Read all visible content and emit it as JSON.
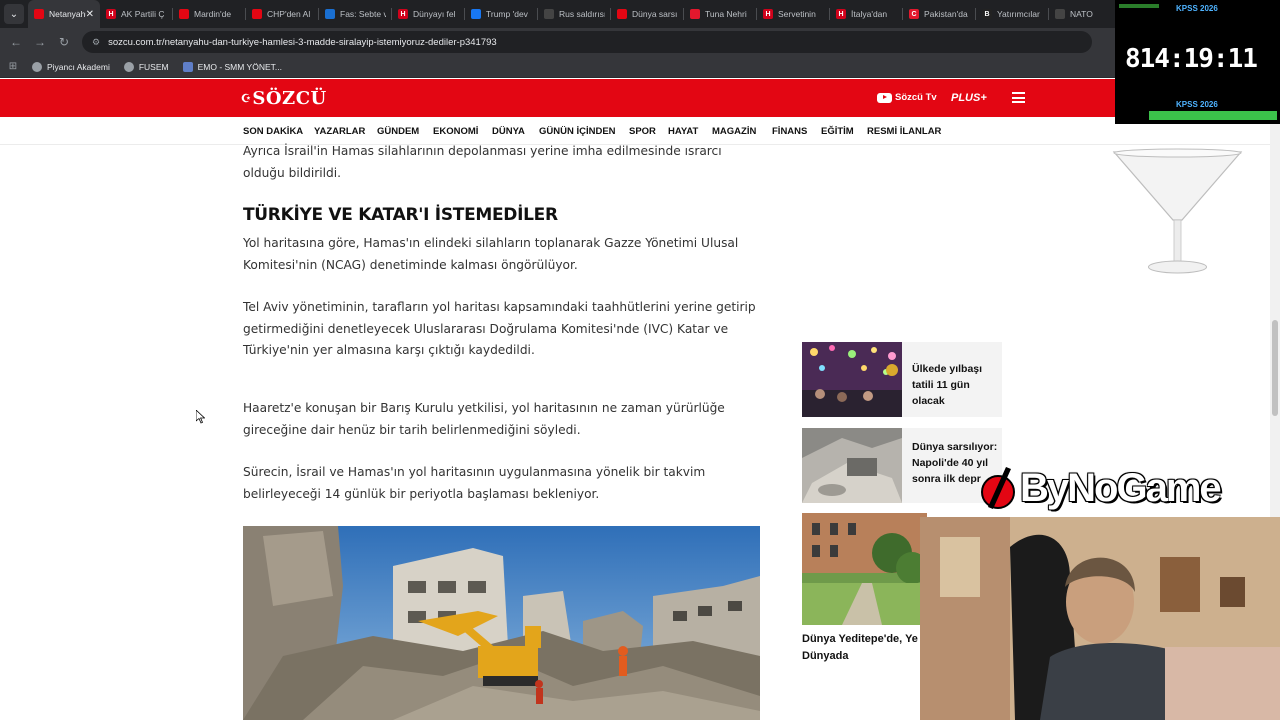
{
  "browser": {
    "tabs": [
      {
        "title": "Netanyahu",
        "favicon_color": "#e30613",
        "active": true
      },
      {
        "title": "AK Partili Ç",
        "favicon_color": "#d0021b",
        "letter": "H"
      },
      {
        "title": "Mardin'de",
        "favicon_color": "#e30613"
      },
      {
        "title": "CHP'den Al",
        "favicon_color": "#e30613"
      },
      {
        "title": "Fas: Sebte v",
        "favicon_color": "#1a6fd1"
      },
      {
        "title": "Dünyayı fel",
        "favicon_color": "#d0021b",
        "letter": "H"
      },
      {
        "title": "Trump 'dev",
        "favicon_color": "#1877f2"
      },
      {
        "title": "Rus saldırısı",
        "favicon_color": "#444444"
      },
      {
        "title": "Dünya sarsı",
        "favicon_color": "#e30613"
      },
      {
        "title": "Tuna Nehri",
        "favicon_color": "#e3182d"
      },
      {
        "title": "Servetinin",
        "favicon_color": "#d0021b",
        "letter": "H"
      },
      {
        "title": "İtalya'dan",
        "favicon_color": "#d0021b",
        "letter": "H"
      },
      {
        "title": "Pakistan'da",
        "favicon_color": "#e3182d",
        "letter": "C"
      },
      {
        "title": "Yatırımcılar",
        "favicon_color": "#222222",
        "letter": "B"
      },
      {
        "title": "NATO",
        "favicon_color": "#444444"
      }
    ],
    "close_glyph": "✕",
    "url": "sozcu.com.tr/netanyahu-dan-turkiye-hamlesi-3-madde-siralayip-istemiyoruz-dediler-p341793",
    "bookmarks": [
      "Piyancı Akademi",
      "FUSEM",
      "EMO - SMM YÖNET..."
    ]
  },
  "site": {
    "logo": "SÖZCÜ",
    "youtube_label": "Sözcü Tv",
    "plus_label": "PLUS+",
    "accent": "#e30613",
    "categories": [
      "SON DAKİKA",
      "YAZARLAR",
      "GÜNDEM",
      "EKONOMİ",
      "DÜNYA",
      "GÜNÜN İÇİNDEN",
      "SPOR",
      "HAYAT",
      "MAGAZİN",
      "FİNANS",
      "EĞİTİM",
      "RESMİ İLANLAR"
    ]
  },
  "article": {
    "para1": "Ayrıca İsrail'in Hamas silahlarının depolanması yerine imha edilmesinde ısrarcı olduğu bildirildi.",
    "subheading": "TÜRKİYE VE KATAR'I İSTEMEDİLER",
    "para2": "Yol haritasına göre, Hamas'ın elindeki silahların toplanarak Gazze Yönetimi Ulusal Komitesi'nin (NCAG) denetiminde kalması öngörülüyor.",
    "para3": "Tel Aviv yönetiminin, tarafların yol haritası kapsamındaki taahhütlerini yerine getirip getirmediğini denetleyecek Uluslararası Doğrulama Komitesi'nde (IVC) Katar ve Türkiye'nin yer almasına karşı çıktığı kaydedildi.",
    "para4": "Haaretz'e konuşan bir Barış Kurulu yetkilisi, yol haritasının ne zaman yürürlüğe gireceğine dair henüz bir tarih belirlenmediğini söyledi.",
    "para5": "Sürecin, İsrail ve Hamas'ın yol haritasının uygulanmasına yönelik bir takvim belirleyeceği 14 günlük bir periyotla başlaması bekleniyor."
  },
  "sidebar": {
    "cards": [
      {
        "title": "Ülkede yılbaşı tatili 11 gün olacak"
      },
      {
        "title": "Dünya sarsılıyor: Napoli'de 40 yıl sonra ilk depr"
      }
    ],
    "big_card_title": "Dünya Yeditepe'de, Ye Dünyada"
  },
  "overlays": {
    "timer": "814:19:11",
    "timer_label_top": "KPSS 2026",
    "timer_label_bottom": "KPSS 2026",
    "watermark": "ByNoGame",
    "accent_blue": "#4fb3ff"
  }
}
